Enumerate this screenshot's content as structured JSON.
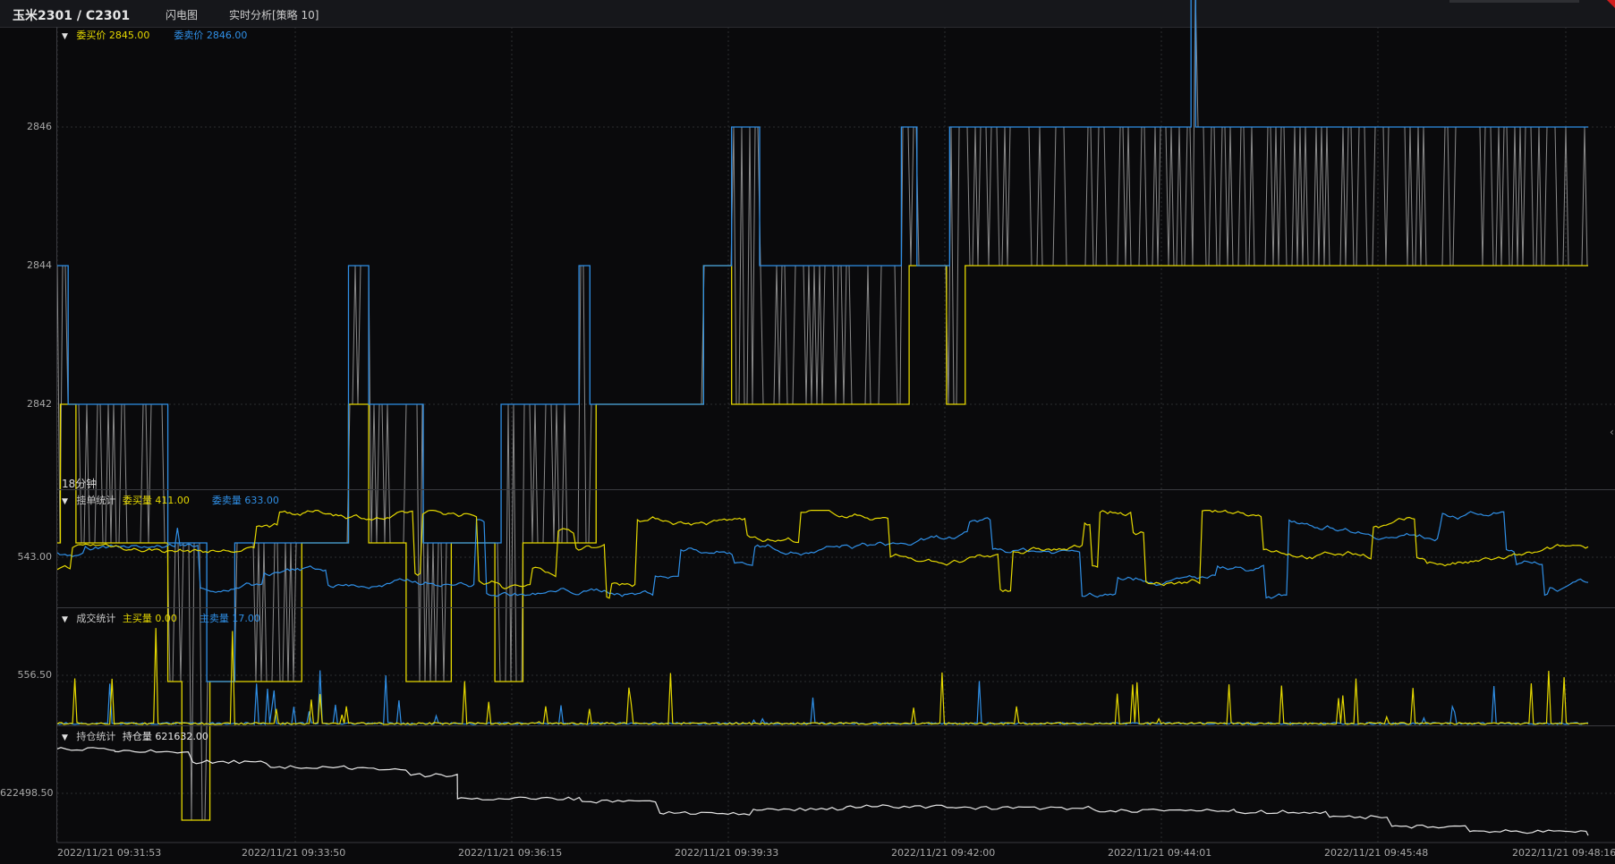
{
  "window": {
    "title": "玉米2301 / C2301",
    "tabs": [
      "闪电图",
      "实时分析[策略 10]"
    ]
  },
  "colors": {
    "background": "#0a0a0c",
    "bid": "#e5d800",
    "ask": "#2f8fe6",
    "mid": "#8a8a8a",
    "open_interest": "#e8e8e8",
    "grid": "#2c2d31"
  },
  "panels": {
    "price": {
      "legend": [
        {
          "label": "委买价",
          "value": "2845.00",
          "color_key": "bid"
        },
        {
          "label": "委卖价",
          "value": "2846.00",
          "color_key": "ask"
        }
      ],
      "span_label": "18分钟",
      "yticks": [
        "2846",
        "2844",
        "2842"
      ]
    },
    "orders": {
      "title": "挂单统计",
      "legend": [
        {
          "label": "委买量",
          "value": "411.00",
          "color_key": "bid"
        },
        {
          "label": "委卖量",
          "value": "633.00",
          "color_key": "ask"
        }
      ],
      "yticks": [
        "543.00"
      ]
    },
    "trades": {
      "title": "成交统计",
      "legend": [
        {
          "label": "主买量",
          "value": "0.00",
          "color_key": "bid"
        },
        {
          "label": "主卖量",
          "value": "17.00",
          "color_key": "ask"
        }
      ],
      "yticks": [
        "556.50"
      ]
    },
    "oi": {
      "title": "持仓统计",
      "legend": [
        {
          "label": "持仓量",
          "value": "621632.00",
          "color_key": "open_interest"
        }
      ],
      "yticks": [
        "622498.50"
      ]
    }
  },
  "xaxis": {
    "labels": [
      "2022/11/21 09:31:53",
      "2022/11/21 09:33:50",
      "2022/11/21 09:36:15",
      "2022/11/21 09:39:33",
      "2022/11/21 09:42:00",
      "2022/11/21 09:44:01",
      "2022/11/21 09:45:48",
      "2022/11/21 09:48:16"
    ]
  },
  "chart_data": {
    "type": "line",
    "time_range": [
      "2022/11/21 09:31:53",
      "2022/11/21 09:48:16"
    ],
    "price_range": [
      2840,
      2847
    ],
    "bid_steps": [
      [
        "09:31:53",
        2843
      ],
      [
        "09:31:55",
        2844
      ],
      [
        "09:32:05",
        2843
      ],
      [
        "09:33:04",
        2842
      ],
      [
        "09:33:13",
        2841
      ],
      [
        "09:33:31",
        2842
      ],
      [
        "09:34:30",
        2843
      ],
      [
        "09:35:00",
        2844
      ],
      [
        "09:35:13",
        2843
      ],
      [
        "09:35:37",
        2842
      ],
      [
        "09:36:06",
        2843
      ],
      [
        "09:36:34",
        2842
      ],
      [
        "09:36:52",
        2843
      ],
      [
        "09:37:39",
        2844
      ],
      [
        "09:38:48",
        2845
      ],
      [
        "09:39:06",
        2844
      ],
      [
        "09:41:00",
        2845
      ],
      [
        "09:41:24",
        2844
      ],
      [
        "09:41:36",
        2845
      ],
      [
        "09:43:41",
        2845
      ]
    ],
    "ask_steps": [
      [
        "09:31:53",
        2845
      ],
      [
        "09:32:00",
        2844
      ],
      [
        "09:33:04",
        2843
      ],
      [
        "09:33:29",
        2842
      ],
      [
        "09:33:47",
        2843
      ],
      [
        "09:35:00",
        2845
      ],
      [
        "09:35:13",
        2844
      ],
      [
        "09:35:48",
        2843
      ],
      [
        "09:36:38",
        2844
      ],
      [
        "09:37:28",
        2845
      ],
      [
        "09:37:35",
        2844
      ],
      [
        "09:38:48",
        2845
      ],
      [
        "09:39:06",
        2846
      ],
      [
        "09:39:24",
        2845
      ],
      [
        "09:40:55",
        2846
      ],
      [
        "09:41:05",
        2845
      ],
      [
        "09:41:26",
        2846
      ],
      [
        "09:44:01",
        2847
      ],
      [
        "09:44:04",
        2846
      ]
    ],
    "order_volume_ytick": 543.0,
    "trade_volume_ytick": 556.5,
    "open_interest": {
      "last": 621632.0,
      "ytick": 622498.5,
      "series": [
        [
          "09:31:53",
          622900
        ],
        [
          "09:32:30",
          622880
        ],
        [
          "09:33:20",
          622800
        ],
        [
          "09:34:10",
          622760
        ],
        [
          "09:35:00",
          622750
        ],
        [
          "09:35:40",
          622700
        ],
        [
          "09:36:10",
          622520
        ],
        [
          "09:37:30",
          622500
        ],
        [
          "09:38:20",
          622410
        ],
        [
          "09:39:20",
          622440
        ],
        [
          "09:40:20",
          622460
        ],
        [
          "09:41:30",
          622450
        ],
        [
          "09:43:00",
          622430
        ],
        [
          "09:44:30",
          622420
        ],
        [
          "09:45:30",
          622380
        ],
        [
          "09:46:10",
          622310
        ],
        [
          "09:47:00",
          622270
        ],
        [
          "09:48:16",
          622240
        ]
      ]
    }
  }
}
